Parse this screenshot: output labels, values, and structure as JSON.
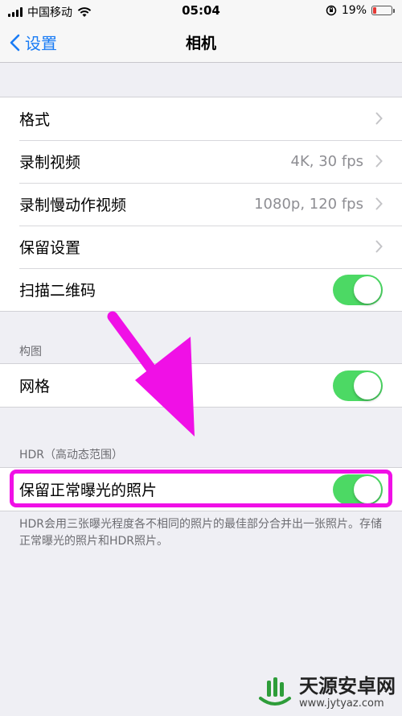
{
  "status_bar": {
    "carrier": "中国移动",
    "time": "05:04",
    "battery_text": "19%",
    "battery_level": 0.19
  },
  "nav": {
    "back_label": "设置",
    "title": "相机"
  },
  "group1": {
    "rows": [
      {
        "label": "格式",
        "value": ""
      },
      {
        "label": "录制视频",
        "value": "4K, 30 fps"
      },
      {
        "label": "录制慢动作视频",
        "value": "1080p, 120 fps"
      },
      {
        "label": "保留设置",
        "value": ""
      },
      {
        "label": "扫描二维码",
        "toggle": true
      }
    ]
  },
  "composition": {
    "header": "构图",
    "grid_label": "网格",
    "grid_on": true
  },
  "hdr": {
    "header": "HDR（高动态范围）",
    "keep_normal_label": "保留正常曝光的照片",
    "keep_normal_on": true,
    "footer": "HDR会用三张曝光程度各不相同的照片的最佳部分合并出一张照片。存储正常曝光的照片和HDR照片。"
  },
  "watermark": {
    "name": "天源安卓网",
    "url": "www.jytyaz.com"
  },
  "colors": {
    "accent": "#1a7cf5",
    "toggle_on": "#4cd964",
    "annotation": "#f010e6"
  }
}
